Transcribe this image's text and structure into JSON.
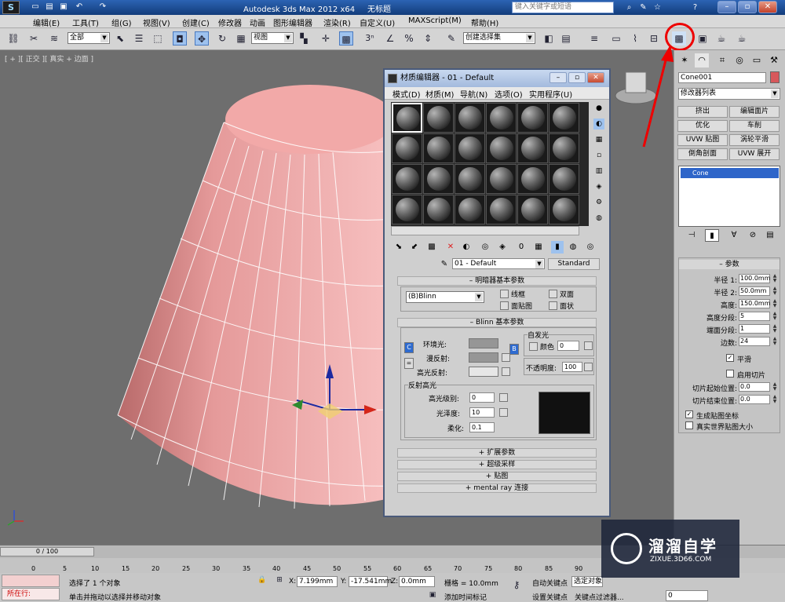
{
  "titlebar": {
    "app_title": "Autodesk 3ds Max  2012 x64",
    "file_title": "无标题",
    "search_placeholder": "键入关键字或短语"
  },
  "menu": [
    "编辑(E)",
    "工具(T)",
    "组(G)",
    "视图(V)",
    "创建(C)",
    "修改器",
    "动画",
    "图形编辑器",
    "渲染(R)",
    "自定义(U)",
    "MAXScript(M)",
    "帮助(H)"
  ],
  "toolbar": {
    "filter_value": "全部",
    "ref_coord": "视图",
    "selection_set": "创建选择集",
    "snap_label": "3"
  },
  "viewport": {
    "label": "[ + ][ 正交 ][ 真实 + 边面 ]",
    "object_color": "#e8a0a0"
  },
  "material_editor": {
    "title": "材质编辑器 - 01 - Default",
    "menus": [
      "模式(D)",
      "材质(M)",
      "导航(N)",
      "选项(O)",
      "实用程序(U)"
    ],
    "material_name": "01 - Default",
    "material_type": "Standard",
    "shader_rollout": "明暗器基本参数",
    "shader_value": "(B)Blinn",
    "checks": [
      "线框",
      "双面",
      "面贴图",
      "面状"
    ],
    "blinn_rollout": "Blinn 基本参数",
    "ambient": "环境光:",
    "diffuse": "漫反射:",
    "specular": "高光反射:",
    "self_illum_group": "自发光",
    "color_label": "颜色",
    "self_illum_value": "0",
    "opacity_label": "不透明度:",
    "opacity_value": "100",
    "spec_group": "反射高光",
    "spec_level_label": "高光级别:",
    "spec_level": "0",
    "gloss_label": "光泽度:",
    "gloss": "10",
    "soften_label": "柔化:",
    "soften": "0.1",
    "rollouts": [
      "扩展参数",
      "超级采样",
      "贴图",
      "mental ray 连接"
    ],
    "side_c": "C",
    "side_b": "B"
  },
  "command_panel": {
    "object_name": "Cone001",
    "object_color": "#d7585b",
    "modifier_list": "修改器列表",
    "mod_buttons": [
      "挤出",
      "编辑面片",
      "优化",
      "车削",
      "UVW 贴图",
      "涡轮平滑",
      "倒角剖面",
      "UVW 展开"
    ],
    "stack_item": "Cone",
    "params_title": "参数",
    "params": [
      {
        "label": "半径 1:",
        "value": "100.0mm"
      },
      {
        "label": "半径 2:",
        "value": "50.0mm"
      },
      {
        "label": "高度:",
        "value": "150.0mm"
      },
      {
        "label": "高度分段:",
        "value": "5"
      },
      {
        "label": "端面分段:",
        "value": "1"
      },
      {
        "label": "边数:",
        "value": "24"
      }
    ],
    "smooth_label": "平滑",
    "slice_label": "启用切片",
    "slice_from_label": "切片起始位置:",
    "slice_from": "0.0",
    "slice_to_label": "切片结束位置:",
    "slice_to": "0.0",
    "gen_map_label": "生成贴图坐标",
    "real_world_label": "真实世界贴图大小"
  },
  "timeline": {
    "frame": "0 / 100",
    "ticks": [
      "0",
      "5",
      "10",
      "15",
      "20",
      "25",
      "30",
      "35",
      "40",
      "45",
      "50",
      "55",
      "60",
      "65",
      "70",
      "75",
      "80",
      "85",
      "90"
    ]
  },
  "status": {
    "script_label": "所在行:",
    "selected": "选择了 1 个对象",
    "prompt": "单击并拖动以选择并移动对象",
    "x_label": "X:",
    "x": "7.199mm",
    "y_label": "Y:",
    "y": "-17.541mm",
    "z_label": "Z:",
    "z": "0.0mm",
    "grid": "栅格 = 10.0mm",
    "add_time_tag": "添加时间标记",
    "auto_key": "自动关键点",
    "set_key": "设置关键点",
    "selected_obj": "选定对象",
    "key_filters": "关键点过滤器...",
    "frame_value": "0"
  },
  "watermark": {
    "text": "溜溜自学",
    "url": "ZIXUE.3D66.COM"
  }
}
